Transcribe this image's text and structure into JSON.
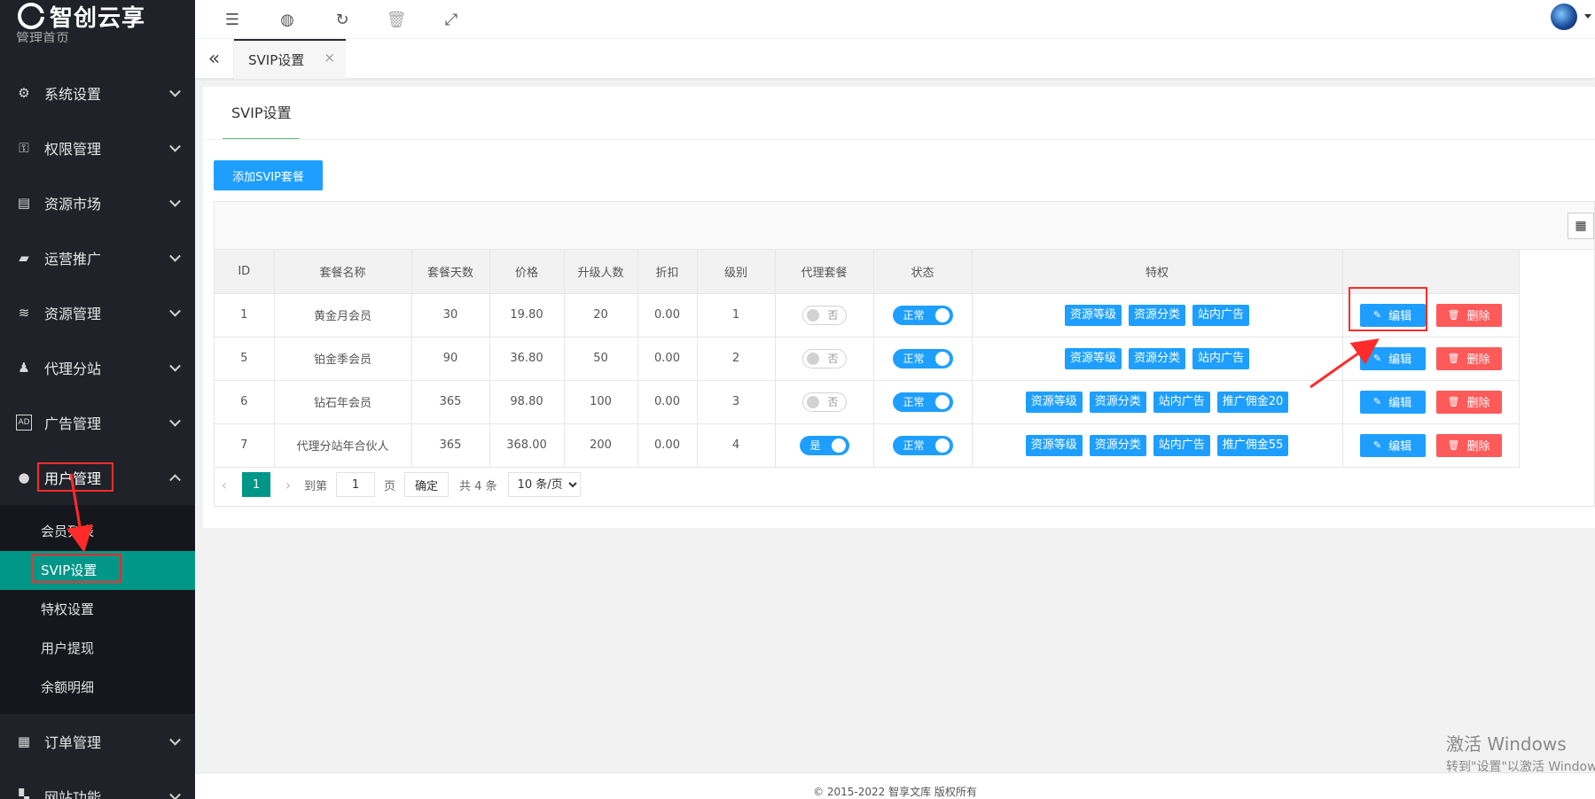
{
  "app": {
    "logo_text": "智创云享",
    "logo_partial_text": "管理首页"
  },
  "sidebar": {
    "items": [
      {
        "label": "系统设置",
        "icon": "gear-icon"
      },
      {
        "label": "权限管理",
        "icon": "user-lock-icon"
      },
      {
        "label": "资源市场",
        "icon": "store-icon"
      },
      {
        "label": "运营推广",
        "icon": "megaphone-icon"
      },
      {
        "label": "资源管理",
        "icon": "layers-icon"
      },
      {
        "label": "代理分站",
        "icon": "users-icon"
      },
      {
        "label": "广告管理",
        "icon": "ad-icon"
      },
      {
        "label": "用户管理",
        "icon": "user-icon"
      }
    ],
    "submenu": [
      "会员列表",
      "SVIP设置",
      "特权设置",
      "用户提现",
      "余额明细"
    ],
    "bottom_items": [
      {
        "label": "订单管理",
        "icon": "order-icon"
      },
      {
        "label": "网站功能",
        "icon": "grid-icon"
      }
    ]
  },
  "tabs": {
    "active": "SVIP设置",
    "close": "×"
  },
  "card": {
    "tab_title": "SVIP设置",
    "add_button": "添加SVIP套餐",
    "columns": [
      "ID",
      "套餐名称",
      "套餐天数",
      "价格",
      "升级人数",
      "折扣",
      "级别",
      "代理套餐",
      "状态",
      "特权",
      ""
    ],
    "rows": [
      {
        "id": "1",
        "name": "黄金月会员",
        "days": "30",
        "price": "19.80",
        "upgrade": "20",
        "discount": "0.00",
        "level": "1",
        "agent": "否",
        "status": "正常",
        "privileges": [
          "资源等级",
          "资源分类",
          "站内广告"
        ]
      },
      {
        "id": "5",
        "name": "铂金季会员",
        "days": "90",
        "price": "36.80",
        "upgrade": "50",
        "discount": "0.00",
        "level": "2",
        "agent": "否",
        "status": "正常",
        "privileges": [
          "资源等级",
          "资源分类",
          "站内广告"
        ]
      },
      {
        "id": "6",
        "name": "钻石年会员",
        "days": "365",
        "price": "98.80",
        "upgrade": "100",
        "discount": "0.00",
        "level": "3",
        "agent": "否",
        "status": "正常",
        "privileges": [
          "资源等级",
          "资源分类",
          "站内广告",
          "推广佣金20"
        ]
      },
      {
        "id": "7",
        "name": "代理分站年合伙人",
        "days": "365",
        "price": "368.00",
        "upgrade": "200",
        "discount": "0.00",
        "level": "4",
        "agent": "是",
        "status": "正常",
        "privileges": [
          "资源等级",
          "资源分类",
          "站内广告",
          "推广佣金55"
        ]
      }
    ],
    "edit_label": "编辑",
    "delete_label": "删除"
  },
  "pager": {
    "current": "1",
    "goto_label": "到第",
    "page_value": "1",
    "page_suffix": "页",
    "confirm": "确定",
    "total": "共 4 条",
    "page_size": "10 条/页"
  },
  "footer": {
    "text": "© 2015-2022 智享文库 版权所有"
  },
  "watermark": {
    "line1": "激活 Windows",
    "line2": "转到\"设置\"以激活 Windows。"
  },
  "colors": {
    "sidebar_bg": "#20222a",
    "active_green": "#009688",
    "primary_blue": "#1e9fff",
    "danger_red": "#ff5a5a",
    "annotation_red": "#ff2b2b"
  }
}
